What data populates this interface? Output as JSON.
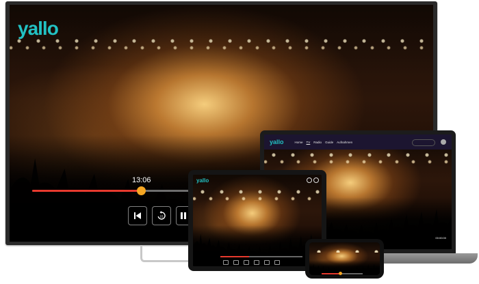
{
  "brand": {
    "logo": "yallo",
    "accent": "#22c1c3"
  },
  "tv": {
    "time_label": "13:06",
    "progress": 0.61,
    "controls": [
      {
        "name": "skip-back",
        "glyph": "⏮"
      },
      {
        "name": "replay",
        "glyph": "↺"
      },
      {
        "name": "pause",
        "glyph": "❚❚"
      }
    ]
  },
  "laptop": {
    "nav": [
      "Home",
      "TV",
      "Radio",
      "Guide",
      "Aufnahmen"
    ],
    "active_nav": "TV",
    "time_label": "00:00:00"
  },
  "tablet": {
    "progress": 0.35
  },
  "phone": {
    "progress": 0.45
  },
  "colors": {
    "progress_fill": "#e83a2e",
    "progress_knob": "#f5a623"
  }
}
